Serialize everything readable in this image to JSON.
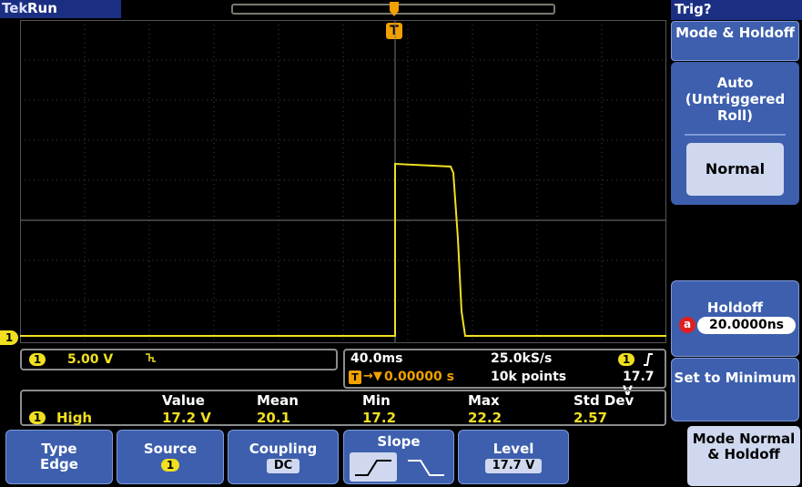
{
  "topbar": {
    "brand": "Tek",
    "status": "Run"
  },
  "trigger_marker": "T",
  "menu": {
    "title": "Trig?",
    "header": "Mode & Holdoff",
    "auto_label": "Auto (Untriggered Roll)",
    "normal_label": "Normal",
    "holdoff_label": "Holdoff",
    "holdoff_knob": "a",
    "holdoff_value": "20.0000ns",
    "set_min_label": "Set to Minimum",
    "mode_holdoff_label": "Mode Normal & Holdoff"
  },
  "channel": {
    "number": "1",
    "scale": "5.00 V",
    "bandwidth_icon": "bandwidth-limit-icon"
  },
  "timebase": {
    "horizontal_scale": "40.0ms",
    "sample_rate": "25.0kS/s",
    "trigger_position": "0.00000 s",
    "record_length": "10k points",
    "trigger_channel": "1",
    "trigger_level": "17.7 V"
  },
  "measurement": {
    "headers": [
      "Value",
      "Mean",
      "Min",
      "Max",
      "Std Dev"
    ],
    "row_label": "High",
    "values": [
      "17.2 V",
      "20.1",
      "17.2",
      "22.2",
      "2.57"
    ]
  },
  "bottom_menu": {
    "type_label": "Type",
    "type_value": "Edge",
    "source_label": "Source",
    "source_value": "1",
    "coupling_label": "Coupling",
    "coupling_value": "DC",
    "slope_label": "Slope",
    "level_label": "Level",
    "level_value": "17.7 V"
  },
  "colors": {
    "trace": "#f0e020",
    "menu_blue": "#3d5fae",
    "title_blue": "#1b2f82",
    "selected": "#cfd8ee"
  }
}
